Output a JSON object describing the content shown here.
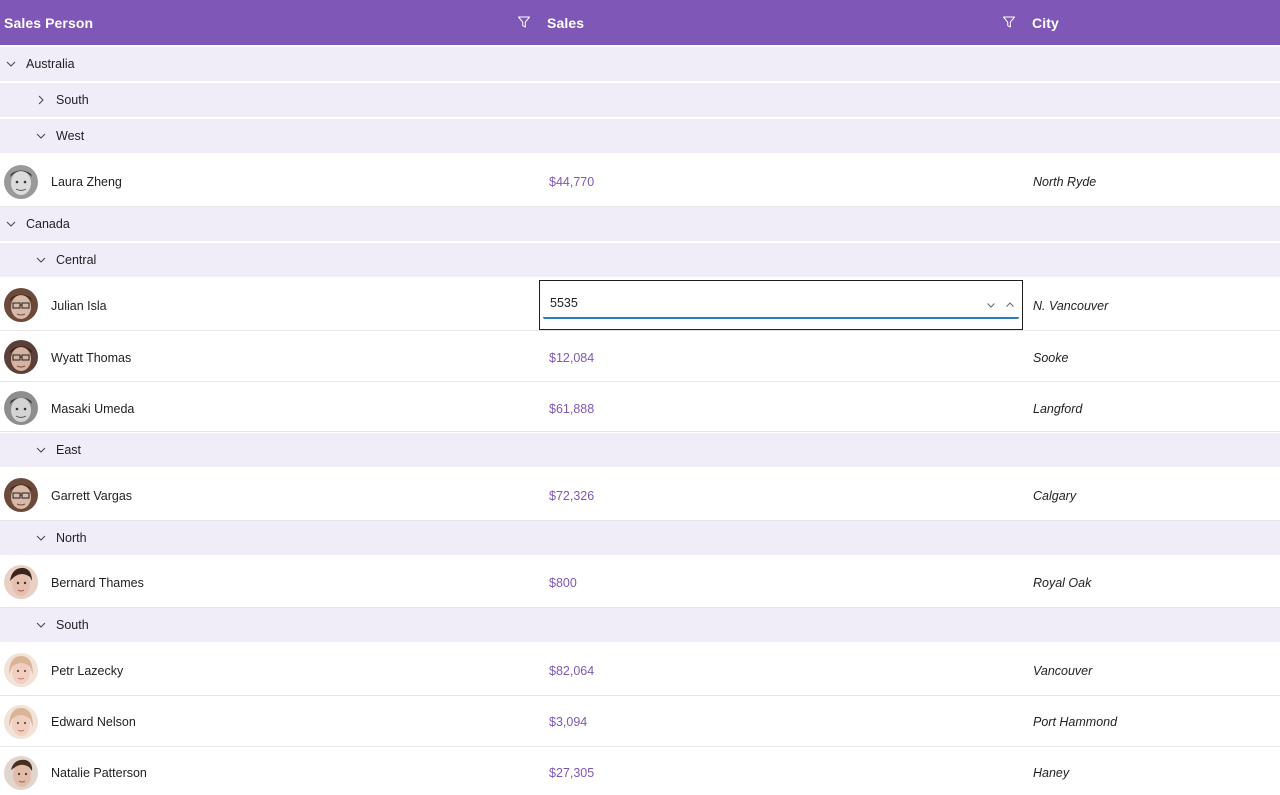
{
  "header": {
    "col1": "Sales Person",
    "col2": "Sales",
    "col3": "City"
  },
  "groups": {
    "australia": "Australia",
    "au_south": "South",
    "au_west": "West",
    "canada": "Canada",
    "ca_central": "Central",
    "ca_east": "East",
    "ca_north": "North",
    "ca_south": "South"
  },
  "rows": [
    {
      "name": "Laura Zheng",
      "sales": "$44,770",
      "city": "North Ryde"
    },
    {
      "name": "Julian Isla",
      "sales": "",
      "city": "N. Vancouver"
    },
    {
      "name": "Wyatt Thomas",
      "sales": "$12,084",
      "city": "Sooke"
    },
    {
      "name": "Masaki Umeda",
      "sales": "$61,888",
      "city": "Langford"
    },
    {
      "name": "Garrett Vargas",
      "sales": "$72,326",
      "city": "Calgary"
    },
    {
      "name": "Bernard Thames",
      "sales": "$800",
      "city": "Royal Oak"
    },
    {
      "name": "Petr Lazecky",
      "sales": "$82,064",
      "city": "Vancouver"
    },
    {
      "name": "Edward Nelson",
      "sales": "$3,094",
      "city": "Port Hammond"
    },
    {
      "name": "Natalie Patterson",
      "sales": "$27,305",
      "city": "Haney"
    }
  ],
  "editor": {
    "value": "5535"
  },
  "colors": {
    "header_bg": "#7e57b7",
    "group_bg": "#f0edf8",
    "sales_text": "#7e57b7",
    "editor_underline": "#2a7bb8"
  },
  "icons": {
    "filter": "filter-icon",
    "expanded": "chevron-down-icon",
    "collapsed": "chevron-right-icon",
    "spin_up": "chevron-up-icon",
    "spin_down": "chevron-down-icon"
  }
}
